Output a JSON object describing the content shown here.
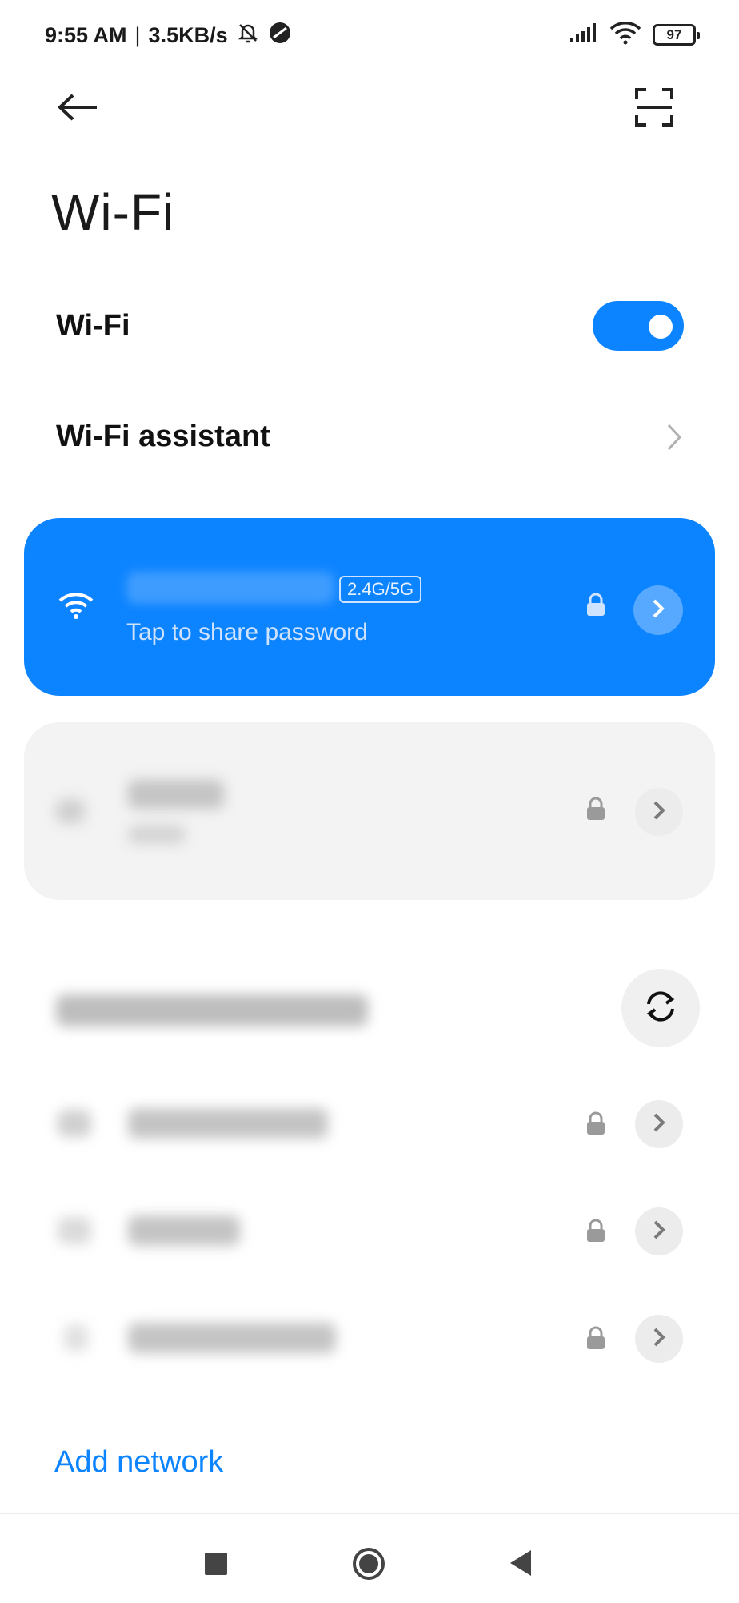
{
  "status_bar": {
    "time": "9:55 AM",
    "separator": "|",
    "speed": "3.5KB/s",
    "battery": "97",
    "icons": [
      "bell-off-icon",
      "app-icon",
      "signal-icon",
      "wifi-icon",
      "battery-icon"
    ]
  },
  "header": {
    "title": "Wi-Fi",
    "back_icon": "arrow-left-icon",
    "scan_icon": "scan-qr-icon"
  },
  "settings": {
    "wifi_label": "Wi-Fi",
    "wifi_enabled": true,
    "assistant_label": "Wi-Fi assistant"
  },
  "connected_network": {
    "band": "2.4G/5G",
    "subtitle": "Tap to share password",
    "secured": true
  },
  "saved_networks": [
    {
      "secured": true
    }
  ],
  "available_networks": {
    "refresh_icon": "refresh-icon",
    "items": [
      {
        "secured": true
      },
      {
        "secured": true
      },
      {
        "secured": true
      }
    ]
  },
  "footer": {
    "add_network_label": "Add network"
  },
  "colors": {
    "accent": "#0d84ff",
    "card_gray": "#f3f3f3"
  }
}
